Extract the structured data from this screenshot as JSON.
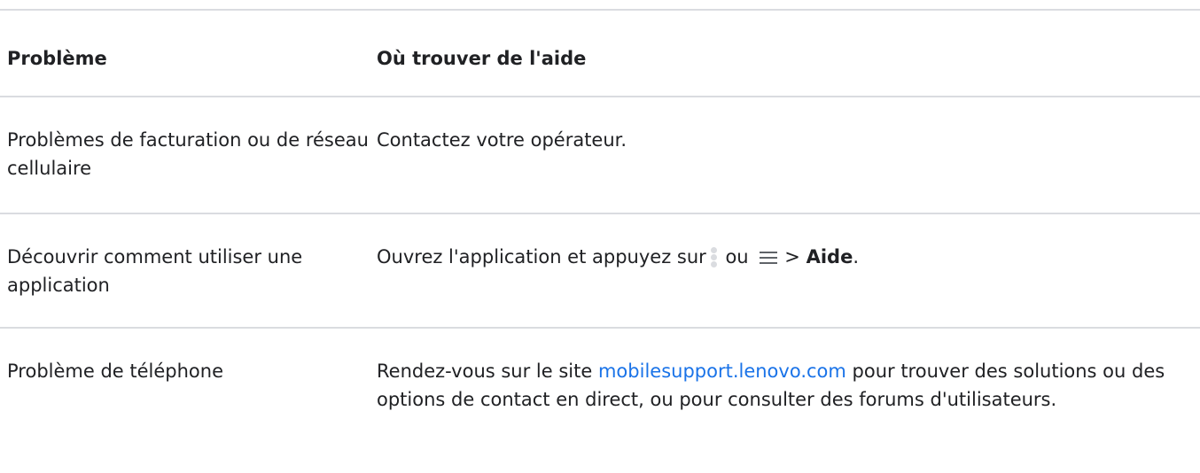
{
  "table": {
    "headers": {
      "problem": "Problème",
      "help": "Où trouver de l'aide"
    },
    "rows": [
      {
        "problem": "Problèmes de facturation ou de réseau cellulaire",
        "help": "Contactez votre opérateur."
      },
      {
        "problem": "Découvrir comment utiliser une application",
        "help_prefix": "Ouvrez l'application et appuyez sur",
        "help_or": "ou",
        "help_arrow": ">",
        "help_bold": "Aide",
        "help_suffix": ".",
        "icons": [
          "more-vert-icon",
          "menu-icon"
        ]
      },
      {
        "problem": "Problème de téléphone",
        "help_prefix": "Rendez-vous sur le site ",
        "help_link": "mobilesupport.lenovo.com",
        "help_suffix": " pour trouver des solutions ou des options de contact en direct, ou pour consulter des forums d'utilisateurs."
      }
    ]
  },
  "colors": {
    "text": "#202124",
    "link": "#1a73e8",
    "divider": "#dadce0"
  }
}
